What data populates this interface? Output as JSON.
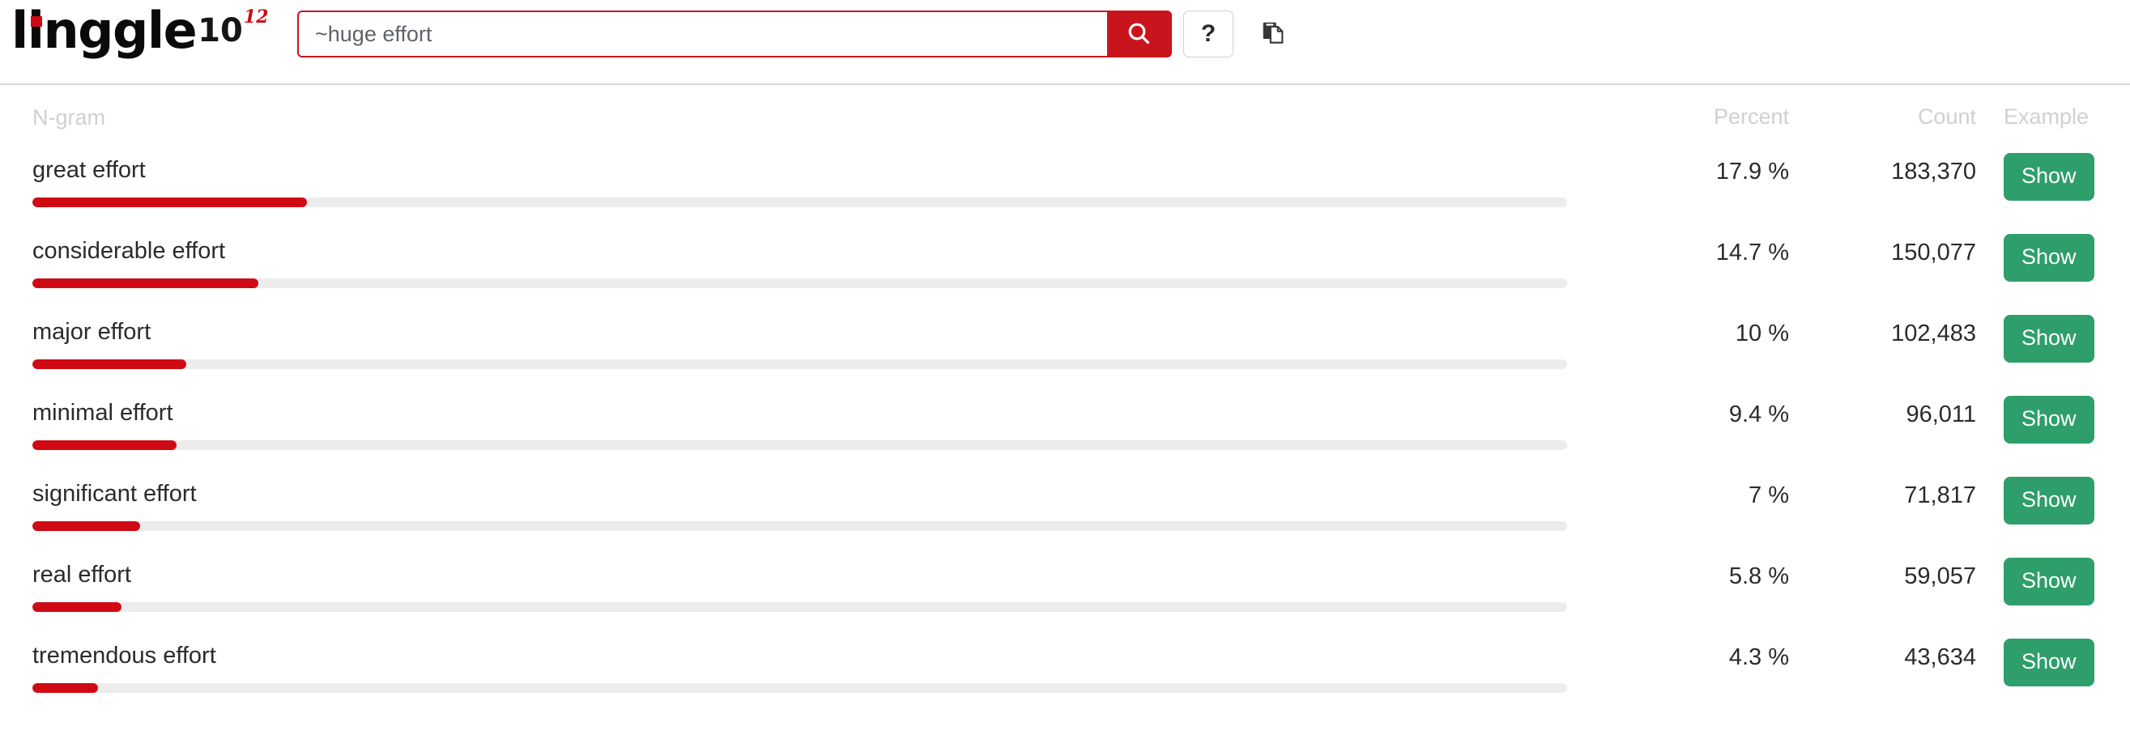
{
  "brand": {
    "name": "linggle",
    "base": "10",
    "exponent": "12",
    "dot_color": "#cf0a14"
  },
  "search": {
    "value": "~huge effort",
    "placeholder": "~huge effort",
    "search_icon": "search-icon",
    "help_label": "?",
    "copy_icon": "copy-icon",
    "accent_color": "#c9141e"
  },
  "table": {
    "headers": {
      "ngram": "N-gram",
      "percent": "Percent",
      "count": "Count",
      "example": "Example"
    },
    "action_label": "Show",
    "bar_color": "#cf0a14",
    "bar_track_color": "#ececec",
    "action_color": "#2e9e6b",
    "rows": [
      {
        "ngram": "great effort",
        "percent": "17.9 %",
        "count": "183,370",
        "bar": 17.9,
        "action": "Show"
      },
      {
        "ngram": "considerable effort",
        "percent": "14.7 %",
        "count": "150,077",
        "bar": 14.7,
        "action": "Show"
      },
      {
        "ngram": "major effort",
        "percent": "10 %",
        "count": "102,483",
        "bar": 10.0,
        "action": "Show"
      },
      {
        "ngram": "minimal effort",
        "percent": "9.4 %",
        "count": "96,011",
        "bar": 9.4,
        "action": "Show"
      },
      {
        "ngram": "significant effort",
        "percent": "7 %",
        "count": "71,817",
        "bar": 7.0,
        "action": "Show"
      },
      {
        "ngram": "real effort",
        "percent": "5.8 %",
        "count": "59,057",
        "bar": 5.8,
        "action": "Show"
      },
      {
        "ngram": "tremendous effort",
        "percent": "4.3 %",
        "count": "43,634",
        "bar": 4.3,
        "action": "Show"
      }
    ]
  },
  "chart_data": {
    "type": "bar",
    "title": "Linggle n-gram frequency for \"~huge effort\"",
    "xlabel": "Percent",
    "ylabel": "N-gram",
    "categories": [
      "great effort",
      "considerable effort",
      "major effort",
      "minimal effort",
      "significant effort",
      "real effort",
      "tremendous effort"
    ],
    "values": [
      17.9,
      14.7,
      10,
      9.4,
      7,
      5.8,
      4.3
    ],
    "counts": [
      183370,
      150077,
      102483,
      96011,
      71817,
      59057,
      43634
    ],
    "xlim": [
      0,
      100
    ],
    "grid": false,
    "legend": "none"
  }
}
